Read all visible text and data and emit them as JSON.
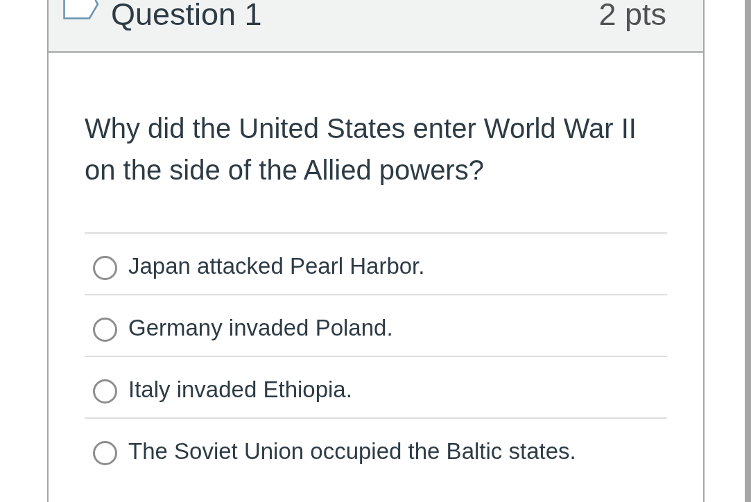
{
  "question": {
    "flagged": false,
    "title": "Question 1",
    "points": "2 pts",
    "text": "Why did the United States enter World War II on the side of the Allied powers?"
  },
  "answers": [
    {
      "label": "Japan attacked Pearl Harbor.",
      "selected": false
    },
    {
      "label": "Germany invaded Poland.",
      "selected": false
    },
    {
      "label": "Italy invaded Ethiopia.",
      "selected": false
    },
    {
      "label": "The Soviet Union occupied the Baltic states.",
      "selected": false
    }
  ]
}
